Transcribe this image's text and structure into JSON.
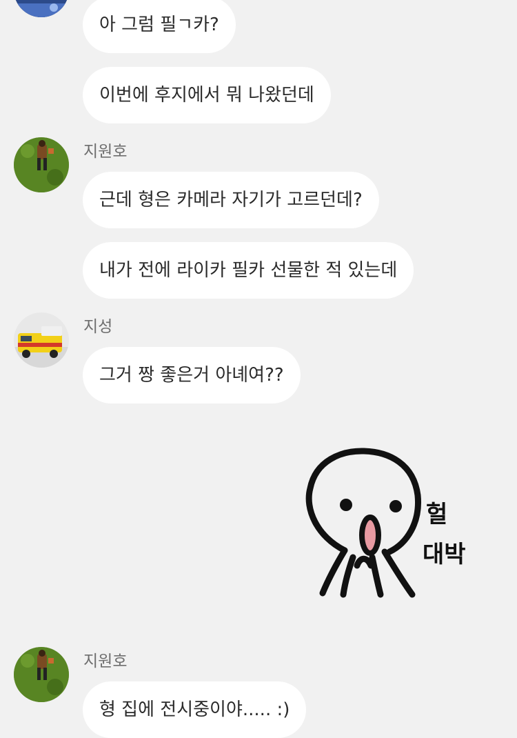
{
  "messages": [
    {
      "text": "아 그럼 필ㄱ카?"
    },
    {
      "text": "이번에 후지에서 뭐 나왔던데"
    },
    {
      "sender": "지원호",
      "text": "근데 형은 카메라 자기가 고르던데?"
    },
    {
      "text": "내가 전에 라이카 필카 선물한 적 있는데"
    },
    {
      "sender": "지성",
      "text": "그거 짱 좋은거 아녜여??"
    },
    {
      "sender": "지원호",
      "text": "형 집에 전시중이야..... :)"
    }
  ],
  "sticker": {
    "icon": "octopus-sticker-icon",
    "line1": "헐",
    "line2": "대박"
  },
  "colors": {
    "background": "#f1f1f1",
    "bubble": "#ffffff",
    "text": "#2a2a2a",
    "sender": "#6e6e6e"
  }
}
